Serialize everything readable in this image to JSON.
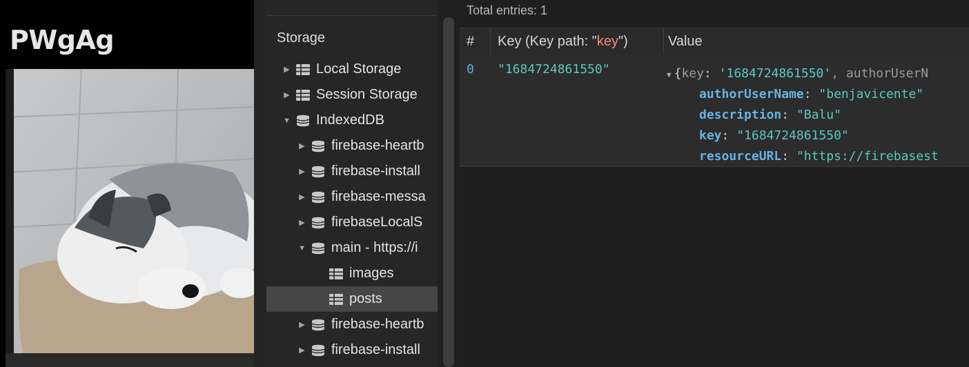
{
  "webpage": {
    "title": "PWgAg"
  },
  "sidebar": {
    "heading": "Storage",
    "items": [
      {
        "label": "Local Storage",
        "icon": "table-icon",
        "arrow": "▶",
        "indent": 0
      },
      {
        "label": "Session Storage",
        "icon": "table-icon",
        "arrow": "▶",
        "indent": 0
      },
      {
        "label": "IndexedDB",
        "icon": "database-icon",
        "arrow": "▼",
        "indent": 0
      },
      {
        "label": "firebase-heartb",
        "icon": "database-icon",
        "arrow": "▶",
        "indent": 1
      },
      {
        "label": "firebase-install",
        "icon": "database-icon",
        "arrow": "▶",
        "indent": 1
      },
      {
        "label": "firebase-messa",
        "icon": "database-icon",
        "arrow": "▶",
        "indent": 1
      },
      {
        "label": "firebaseLocalS",
        "icon": "database-icon",
        "arrow": "▶",
        "indent": 1
      },
      {
        "label": "main - https://i",
        "icon": "database-icon",
        "arrow": "▼",
        "indent": 1
      },
      {
        "label": "images",
        "icon": "table-icon",
        "arrow": "",
        "indent": 2
      },
      {
        "label": "posts",
        "icon": "table-icon",
        "arrow": "",
        "indent": 2,
        "selected": true
      },
      {
        "label": "firebase-heartb",
        "icon": "database-icon",
        "arrow": "▶",
        "indent": 1
      },
      {
        "label": "firebase-install",
        "icon": "database-icon",
        "arrow": "▶",
        "indent": 1
      }
    ]
  },
  "data_view": {
    "total_entries": "Total entries: 1",
    "columns": {
      "index": "#",
      "key_prefix": "Key (Key path: \"",
      "key_path": "key",
      "key_suffix": "\")",
      "value": "Value"
    },
    "row": {
      "index": "0",
      "key": "\"1684724861550\"",
      "value_summary_arrow": "▼",
      "value_summary_open": "{",
      "value_summary_prop": "key",
      "value_summary_colon": ": ",
      "value_summary_val": "'1684724861550'",
      "value_summary_rest": ", authorUserN",
      "props": [
        {
          "name": "authorUserName",
          "value": "\"benjavicente\""
        },
        {
          "name": "description",
          "value": "\"Balu\""
        },
        {
          "name": "key",
          "value": "\"1684724861550\""
        },
        {
          "name": "resourceURL",
          "value": "\"https://firebasest"
        }
      ]
    }
  },
  "colors": {
    "key_path_accent": "#f28b82",
    "string_value": "#5ac8c0",
    "property_name": "#66b3e3",
    "selected_row": "#454545"
  }
}
